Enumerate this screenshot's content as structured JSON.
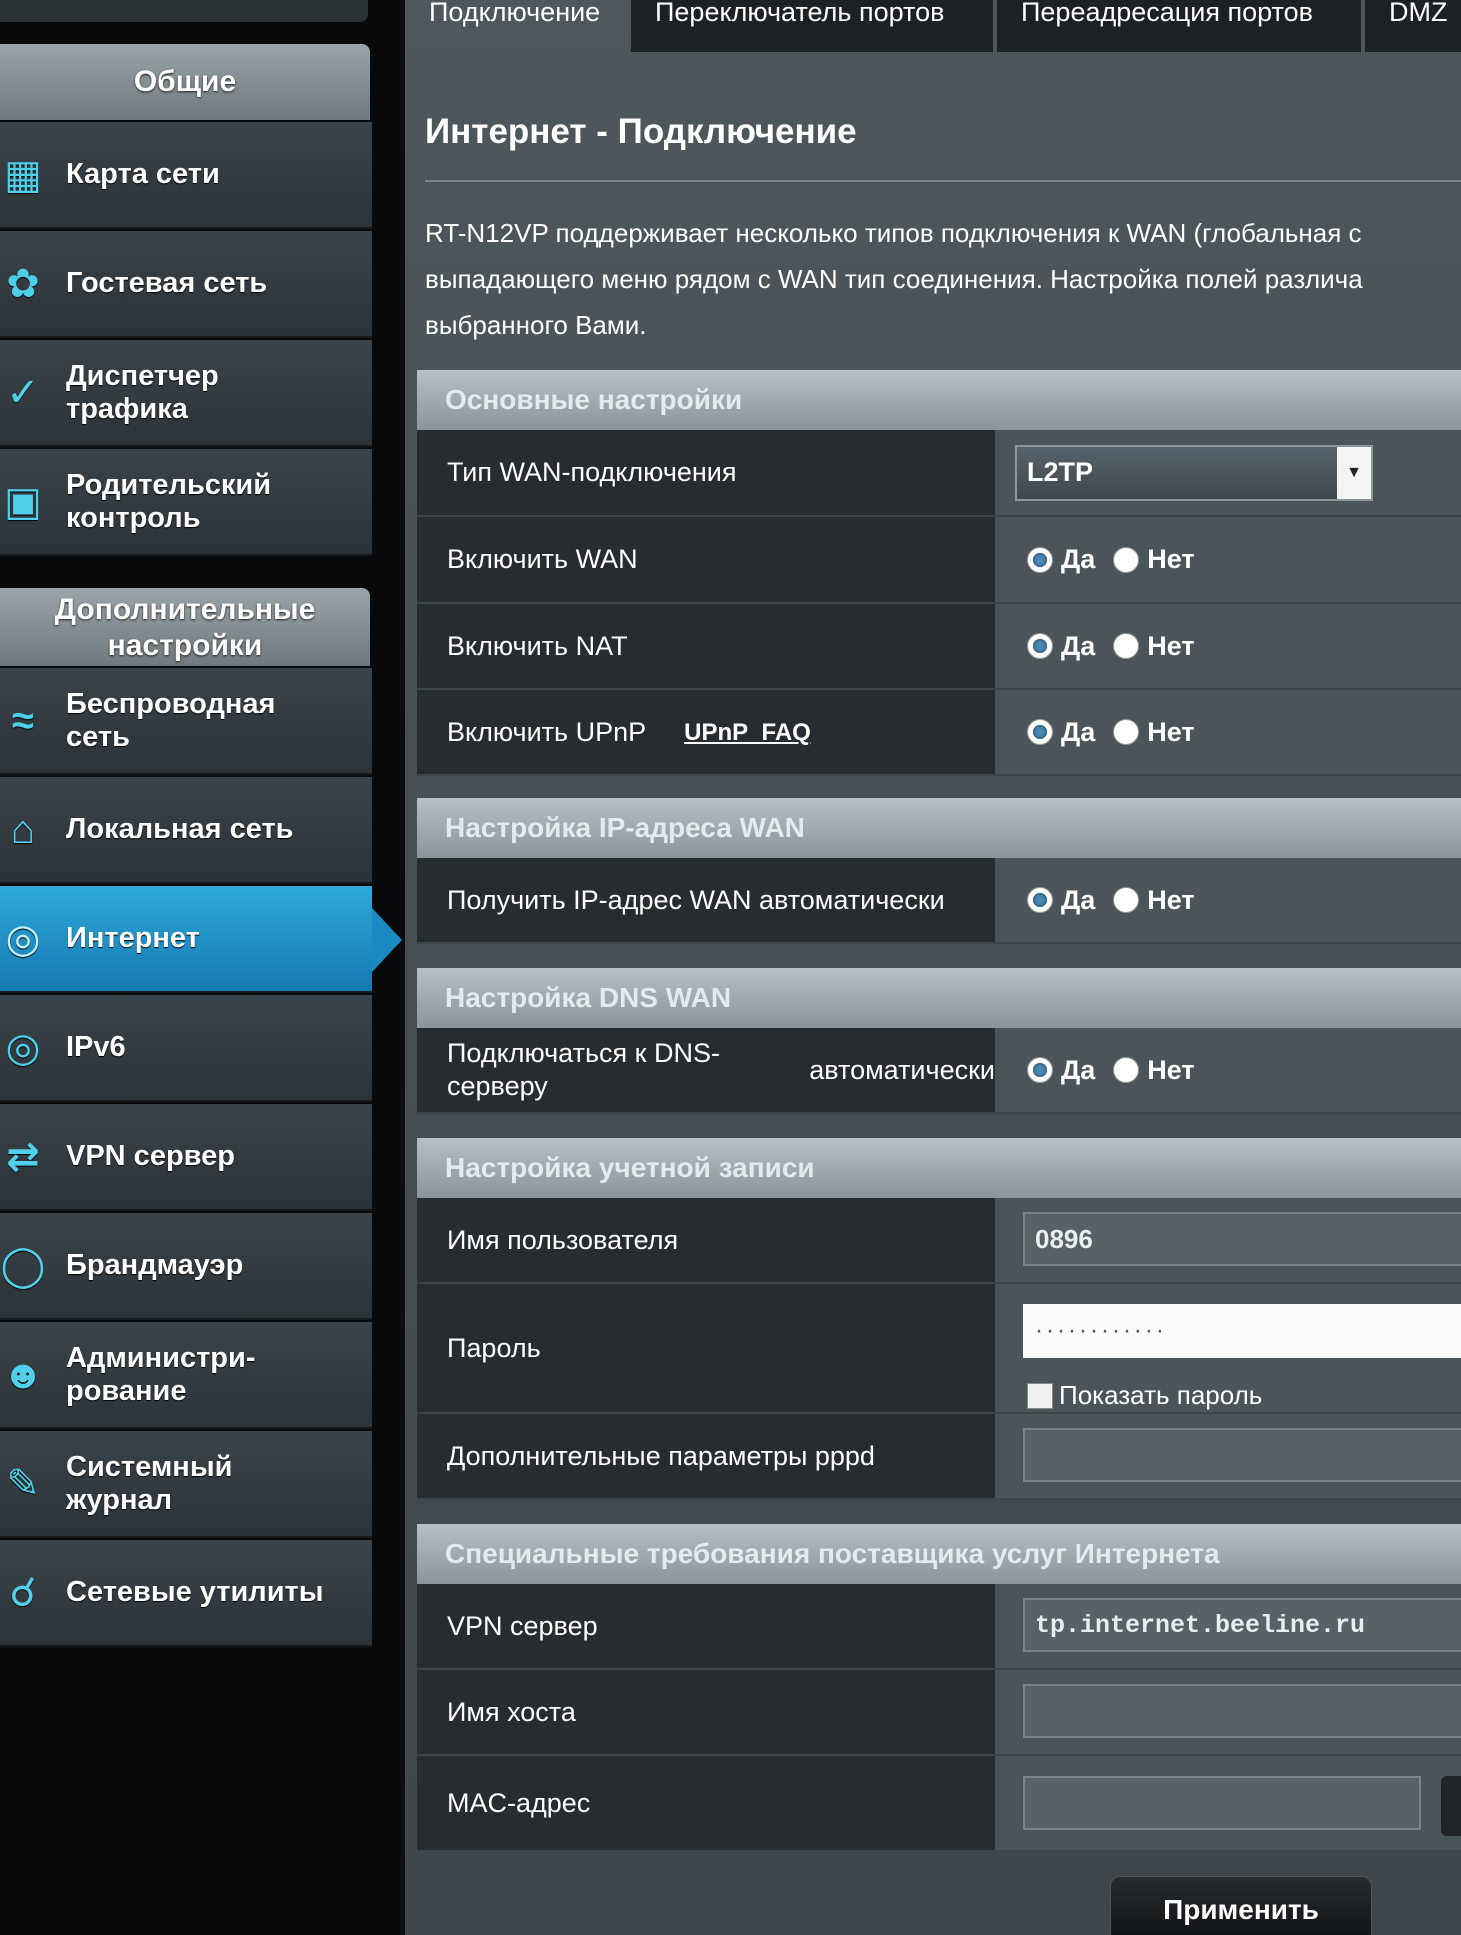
{
  "sidebar": {
    "section_general": "Общие",
    "section_advanced_line1": "Дополнительные",
    "section_advanced_line2": "настройки",
    "items": [
      {
        "label1": "Карта сети",
        "label2": ""
      },
      {
        "label1": "Гостевая сеть",
        "label2": ""
      },
      {
        "label1": "Диспетчер",
        "label2": "трафика"
      },
      {
        "label1": "Родительский",
        "label2": "контроль"
      },
      {
        "label1": "Беспроводная",
        "label2": "сеть"
      },
      {
        "label1": "Локальная сеть",
        "label2": ""
      },
      {
        "label1": "Интернет",
        "label2": ""
      },
      {
        "label1": "IPv6",
        "label2": ""
      },
      {
        "label1": "VPN сервер",
        "label2": ""
      },
      {
        "label1": "Брандмауэр",
        "label2": ""
      },
      {
        "label1": "Администри-",
        "label2": "рование"
      },
      {
        "label1": "Системный",
        "label2": "журнал"
      },
      {
        "label1": "Сетевые утилиты",
        "label2": ""
      }
    ],
    "active_item": "Интернет"
  },
  "tabs": [
    {
      "label": "Подключение"
    },
    {
      "label": "Переключатель портов"
    },
    {
      "label": "Переадресация портов"
    },
    {
      "label": "DMZ"
    }
  ],
  "page": {
    "title": "Интернет - Подключение",
    "desc_line1": "RT-N12VP поддерживает несколько типов подключения к WAN (глобальная с",
    "desc_line2": "выпадающего меню рядом с WAN тип соединения. Настройка полей различа",
    "desc_line3": "выбранного Вами."
  },
  "radio": {
    "yes": "Да",
    "no": "Нет"
  },
  "basic": {
    "heading": "Основные настройки",
    "wan_type_label": "Тип WAN-подключения",
    "wan_type_value": "L2TP",
    "enable_wan_label": "Включить WAN",
    "enable_nat_label": "Включить NAT",
    "enable_upnp_label": "Включить UPnP",
    "upnp_faq": "UPnP_FAQ"
  },
  "wan_ip": {
    "heading": "Настройка IP-адреса WAN",
    "auto_ip_label": "Получить IP-адрес WAN автоматически"
  },
  "dns": {
    "heading": "Настройка DNS WAN",
    "auto_dns_label1": "Подключаться к DNS-серверу",
    "auto_dns_label2": "автоматически"
  },
  "account": {
    "heading": "Настройка учетной записи",
    "username_label": "Имя пользователя",
    "username_value": "0896",
    "password_label": "Пароль",
    "password_value": "············",
    "show_password_label": "Показать пароль",
    "pppd_label": "Дополнительные параметры pppd",
    "pppd_value": ""
  },
  "isp": {
    "heading": "Специальные требования поставщика услуг Интернета",
    "vpn_server_label": "VPN сервер",
    "vpn_server_value": "tp.internet.beeline.ru",
    "hostname_label": "Имя хоста",
    "hostname_value": "",
    "mac_label": "MAC-адрес",
    "mac_value": ""
  },
  "apply_label": "Применить"
}
